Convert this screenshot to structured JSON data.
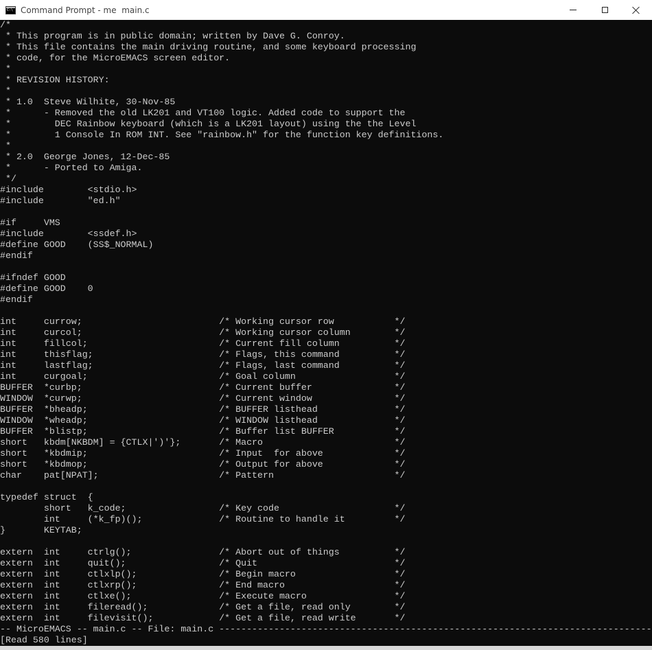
{
  "window": {
    "title": "Command Prompt - me  main.c",
    "icon": "cmd-icon",
    "controls": {
      "minimize_icon": "minimize-icon",
      "maximize_icon": "maximize-icon",
      "close_icon": "close-icon"
    }
  },
  "editor": {
    "lines": [
      "/*",
      " * This program is in public domain; written by Dave G. Conroy.",
      " * This file contains the main driving routine, and some keyboard processing",
      " * code, for the MicroEMACS screen editor.",
      " *",
      " * REVISION HISTORY:",
      " *",
      " * 1.0  Steve Wilhite, 30-Nov-85",
      " *      - Removed the old LK201 and VT100 logic. Added code to support the",
      " *        DEC Rainbow keyboard (which is a LK201 layout) using the the Level",
      " *        1 Console In ROM INT. See \"rainbow.h\" for the function key definitions.",
      " *",
      " * 2.0  George Jones, 12-Dec-85",
      " *      - Ported to Amiga.",
      " */",
      "#include        <stdio.h>",
      "#include        \"ed.h\"",
      "",
      "#if     VMS",
      "#include        <ssdef.h>",
      "#define GOOD    (SS$_NORMAL)",
      "#endif",
      "",
      "#ifndef GOOD",
      "#define GOOD    0",
      "#endif",
      "",
      "int     currow;                         /* Working cursor row           */",
      "int     curcol;                         /* Working cursor column        */",
      "int     fillcol;                        /* Current fill column          */",
      "int     thisflag;                       /* Flags, this command          */",
      "int     lastflag;                       /* Flags, last command          */",
      "int     curgoal;                        /* Goal column                  */",
      "BUFFER  *curbp;                         /* Current buffer               */",
      "WINDOW  *curwp;                         /* Current window               */",
      "BUFFER  *bheadp;                        /* BUFFER listhead              */",
      "WINDOW  *wheadp;                        /* WINDOW listhead              */",
      "BUFFER  *blistp;                        /* Buffer list BUFFER           */",
      "short   kbdm[NKBDM] = {CTLX|')'};       /* Macro                        */",
      "short   *kbdmip;                        /* Input  for above             */",
      "short   *kbdmop;                        /* Output for above             */",
      "char    pat[NPAT];                      /* Pattern                      */",
      "",
      "typedef struct  {",
      "        short   k_code;                 /* Key code                     */",
      "        int     (*k_fp)();              /* Routine to handle it         */",
      "}       KEYTAB;",
      "",
      "extern  int     ctrlg();                /* Abort out of things          */",
      "extern  int     quit();                 /* Quit                         */",
      "extern  int     ctlxlp();               /* Begin macro                  */",
      "extern  int     ctlxrp();               /* End macro                    */",
      "extern  int     ctlxe();                /* Execute macro                */",
      "extern  int     fileread();             /* Get a file, read only        */",
      "extern  int     filevisit();            /* Get a file, read write       */"
    ],
    "mode_line": "-- MicroEMACS -- main.c -- File: main.c ---------------------------------------------------------------------------------",
    "message_line": "[Read 580 lines]"
  },
  "colors": {
    "console_background": "#0c0c0c",
    "console_text": "#cccccc",
    "titlebar_background": "#ffffff"
  }
}
